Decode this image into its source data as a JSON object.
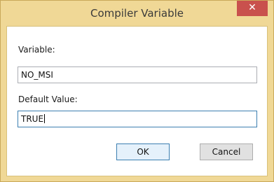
{
  "window": {
    "title": "Compiler Variable",
    "close_glyph": "✕"
  },
  "form": {
    "variable_label": "Variable:",
    "variable_value": "NO_MSI",
    "default_label": "Default Value:",
    "default_value": "TRUE"
  },
  "buttons": {
    "ok_label": "OK",
    "cancel_label": "Cancel"
  },
  "colors": {
    "frame": "#f0d896",
    "close_button": "#c9514d",
    "focus_border": "#3c7fb1"
  }
}
